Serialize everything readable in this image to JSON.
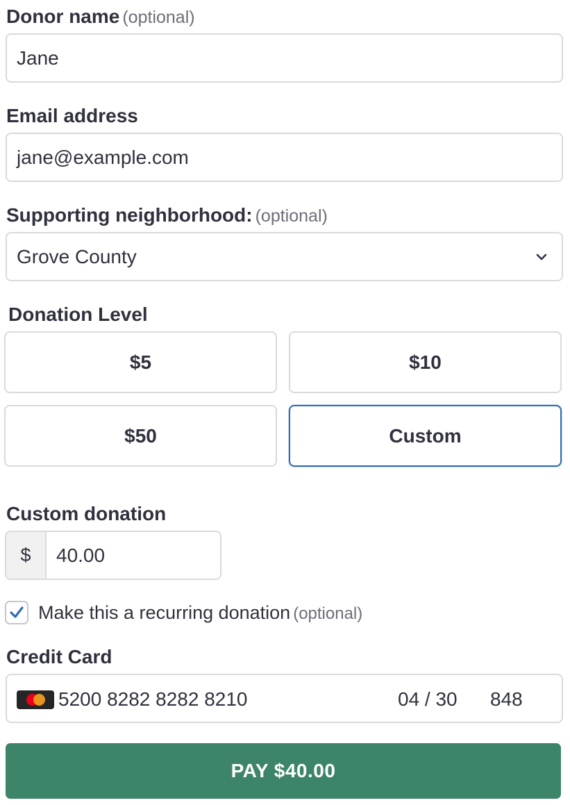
{
  "donor_name": {
    "label": "Donor name",
    "optional_hint": "(optional)",
    "value": "Jane"
  },
  "email": {
    "label": "Email address",
    "value": "jane@example.com"
  },
  "neighborhood": {
    "label": "Supporting neighborhood:",
    "optional_hint": "(optional)",
    "selected": "Grove County",
    "icon": "chevron-down-icon"
  },
  "donation_level": {
    "label": "Donation Level",
    "options": [
      "$5",
      "$10",
      "$50",
      "Custom"
    ],
    "selected": "Custom"
  },
  "custom_donation": {
    "label": "Custom donation",
    "currency_symbol": "$",
    "value": "40.00"
  },
  "recurring": {
    "label": "Make this a recurring donation",
    "optional_hint": "(optional)",
    "checked": true
  },
  "credit_card": {
    "label": "Credit Card",
    "brand_icon": "mastercard-icon",
    "number": "5200 8282 8282 8210",
    "expiry": "04 / 30",
    "cvc": "848"
  },
  "pay_button": {
    "label": "PAY $40.00",
    "color": "#3d8568"
  },
  "colors": {
    "accent": "#2f6bb3",
    "text": "#30313d",
    "muted": "#6d6e78",
    "border": "#d9dadd"
  }
}
